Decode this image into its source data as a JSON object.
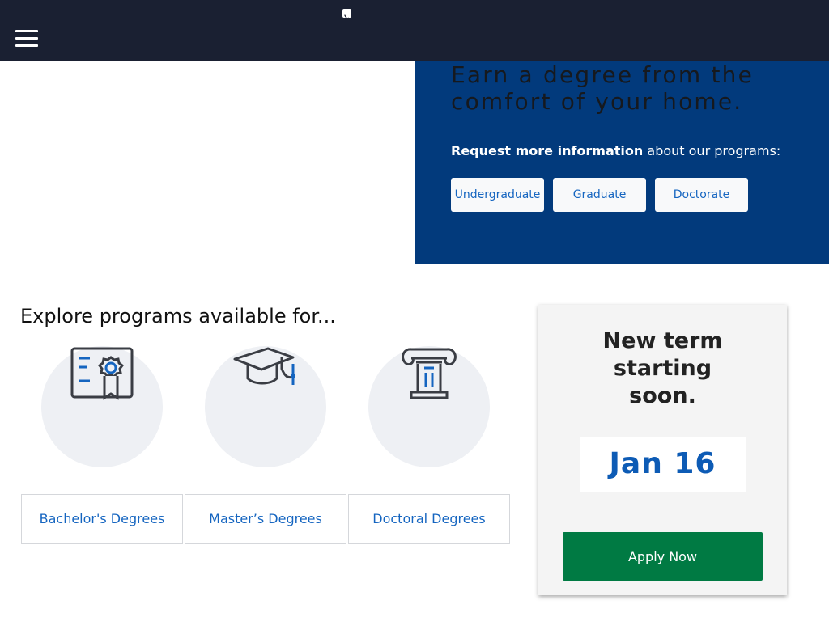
{
  "header": {
    "menu_icon": "hamburger-menu-icon",
    "phone_icon": "phone-icon",
    "background_color": "#1a2032"
  },
  "hero": {
    "title": "Earn a degree from the comfort of your home.",
    "info_bold": "Request more information",
    "info_rest": " about our programs:",
    "background_color": "#023a7c",
    "levels": [
      {
        "label": "Undergraduate"
      },
      {
        "label": "Graduate"
      },
      {
        "label": "Doctorate"
      }
    ]
  },
  "explore": {
    "heading": "Explore programs available for...",
    "programs": [
      {
        "label": "Bachelor's Degrees",
        "icon": "certificate-icon"
      },
      {
        "label": "Master’s Degrees",
        "icon": "graduation-cap-icon"
      },
      {
        "label": "Doctoral Degrees",
        "icon": "ionic-column-icon"
      }
    ]
  },
  "term": {
    "title": "New term starting soon.",
    "date": "Jan 16",
    "apply_label": "Apply Now",
    "apply_color": "#007a43",
    "date_color": "#0d5bb5"
  }
}
